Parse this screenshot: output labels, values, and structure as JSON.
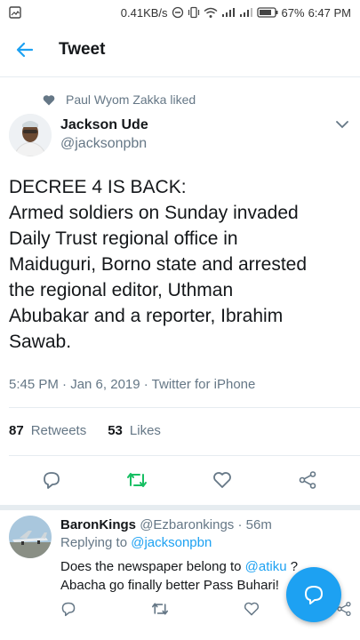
{
  "status_bar": {
    "network_speed": "0.41KB/s",
    "battery": "67%",
    "time": "6:47 PM",
    "icons": [
      "image-icon",
      "do-not-disturb-icon",
      "vibrate-icon",
      "wifi-icon",
      "signal-icon",
      "signal-icon",
      "battery-icon"
    ]
  },
  "header": {
    "title": "Tweet"
  },
  "social_context": {
    "text": "Paul Wyom Zakka liked"
  },
  "tweet": {
    "author_name": "Jackson Ude",
    "author_handle": "@jacksonpbn",
    "lines": [
      "DECREE 4 IS BACK:",
      "Armed soldiers on Sunday invaded",
      "Daily Trust regional office in",
      "Maiduguri, Borno state and arrested",
      "the regional editor, Uthman",
      "Abubakar and a reporter, Ibrahim",
      "Sawab."
    ],
    "timestamp": "5:45 PM · Jan 6, 2019 · Twitter for iPhone",
    "retweets_count": "87",
    "retweets_label": "Retweets",
    "likes_count": "53",
    "likes_label": "Likes"
  },
  "reply": {
    "name": "BaronKings",
    "handle": "@Ezbaronkings",
    "time": "· 56m",
    "replying_prefix": "Replying to ",
    "replying_handle": "@jacksonpbn",
    "body_line1_pre": "Does the newspaper belong to ",
    "body_mention": "@atiku",
    "body_line1_post": " ?",
    "body_line2": "Abacha go finally better Pass Buhari!"
  },
  "colors": {
    "accent": "#1da1f2",
    "retweet_green": "#17bf63",
    "muted": "#657786",
    "text": "#14171a"
  }
}
